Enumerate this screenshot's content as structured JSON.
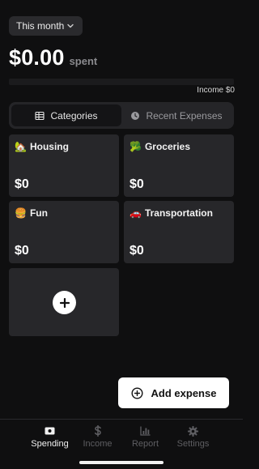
{
  "period_selector": {
    "label": "This month",
    "icon": "chevron-down-icon"
  },
  "summary": {
    "amount": "$0.00",
    "spent_label": "spent",
    "income_note": "Income $0",
    "progress_fraction": 0
  },
  "view_toggle": {
    "tabs": [
      {
        "label": "Categories",
        "icon": "grid-icon",
        "active": true
      },
      {
        "label": "Recent Expenses",
        "icon": "clock-icon",
        "active": false
      }
    ]
  },
  "categories": [
    {
      "emoji": "🏡",
      "name": "Housing",
      "amount": "$0"
    },
    {
      "emoji": "🥦",
      "name": "Groceries",
      "amount": "$0"
    },
    {
      "emoji": "🍔",
      "name": "Fun",
      "amount": "$0"
    },
    {
      "emoji": "🚗",
      "name": "Transportation",
      "amount": "$0"
    }
  ],
  "add_category": {
    "icon": "plus-icon"
  },
  "add_expense": {
    "label": "Add expense",
    "icon": "plus-circle-icon"
  },
  "tabbar": {
    "items": [
      {
        "label": "Spending",
        "icon": "wallet-icon",
        "active": true
      },
      {
        "label": "Income",
        "icon": "dollar-icon",
        "active": false
      },
      {
        "label": "Report",
        "icon": "bar-chart-icon",
        "active": false
      },
      {
        "label": "Settings",
        "icon": "gear-icon",
        "active": false
      }
    ]
  },
  "colors": {
    "background": "#0f0f10",
    "tile": "#27272a",
    "accent": "#ffffff",
    "muted": "#5e5e62"
  }
}
